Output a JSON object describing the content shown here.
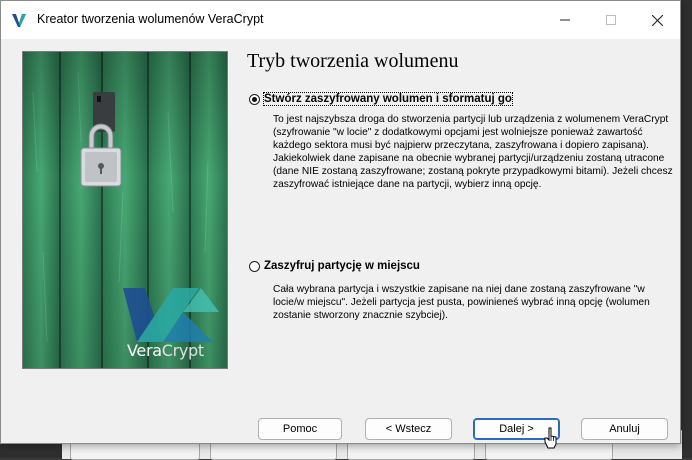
{
  "window": {
    "title": "Kreator tworzenia wolumenów VeraCrypt"
  },
  "branding": {
    "logo_text_part1": "Vera",
    "logo_text_part2": "Crypt"
  },
  "page": {
    "heading": "Tryb tworzenia wolumenu"
  },
  "options": [
    {
      "label": "Stwórz zaszyfrowany wolumen i sformatuj go",
      "selected": true,
      "description": "To jest najszybsza droga do stworzenia partycji lub urządzenia z wolumenem VeraCrypt (szyfrowanie \"w locie\" z dodatkowymi opcjami jest wolniejsze ponieważ zawartość każdego sektora musi być najpierw przeczytana, zaszyfrowana i dopiero zapisana). Jakiekolwiek dane zapisane na obecnie wybranej partycji/urządzeniu zostaną utracone (dane NIE zostaną zaszyfrowane; zostaną pokryte przypadkowymi bitami). Jeżeli chcesz zaszyfrować istniejące dane na partycji, wybierz inną opcję."
    },
    {
      "label": "Zaszyfruj partycję w miejscu",
      "selected": false,
      "description": "Cała wybrana partycja i wszystkie zapisane na niej dane zostaną zaszyfrowane \"w locie/w miejscu\". Jeżeli partycja jest pusta, powinieneś wybrać inną opcję (wolumen zostanie stworzony znacznie szybciej)."
    }
  ],
  "buttons": {
    "help": "Pomoc",
    "back": "< Wstecz",
    "next": "Dalej >",
    "cancel": "Anuluj"
  },
  "colors": {
    "accent_blue": "#2a69c7",
    "logo_dark_blue": "#1e4f8f",
    "logo_teal": "#2aa7a0",
    "door_green": "#3f9a6a"
  }
}
